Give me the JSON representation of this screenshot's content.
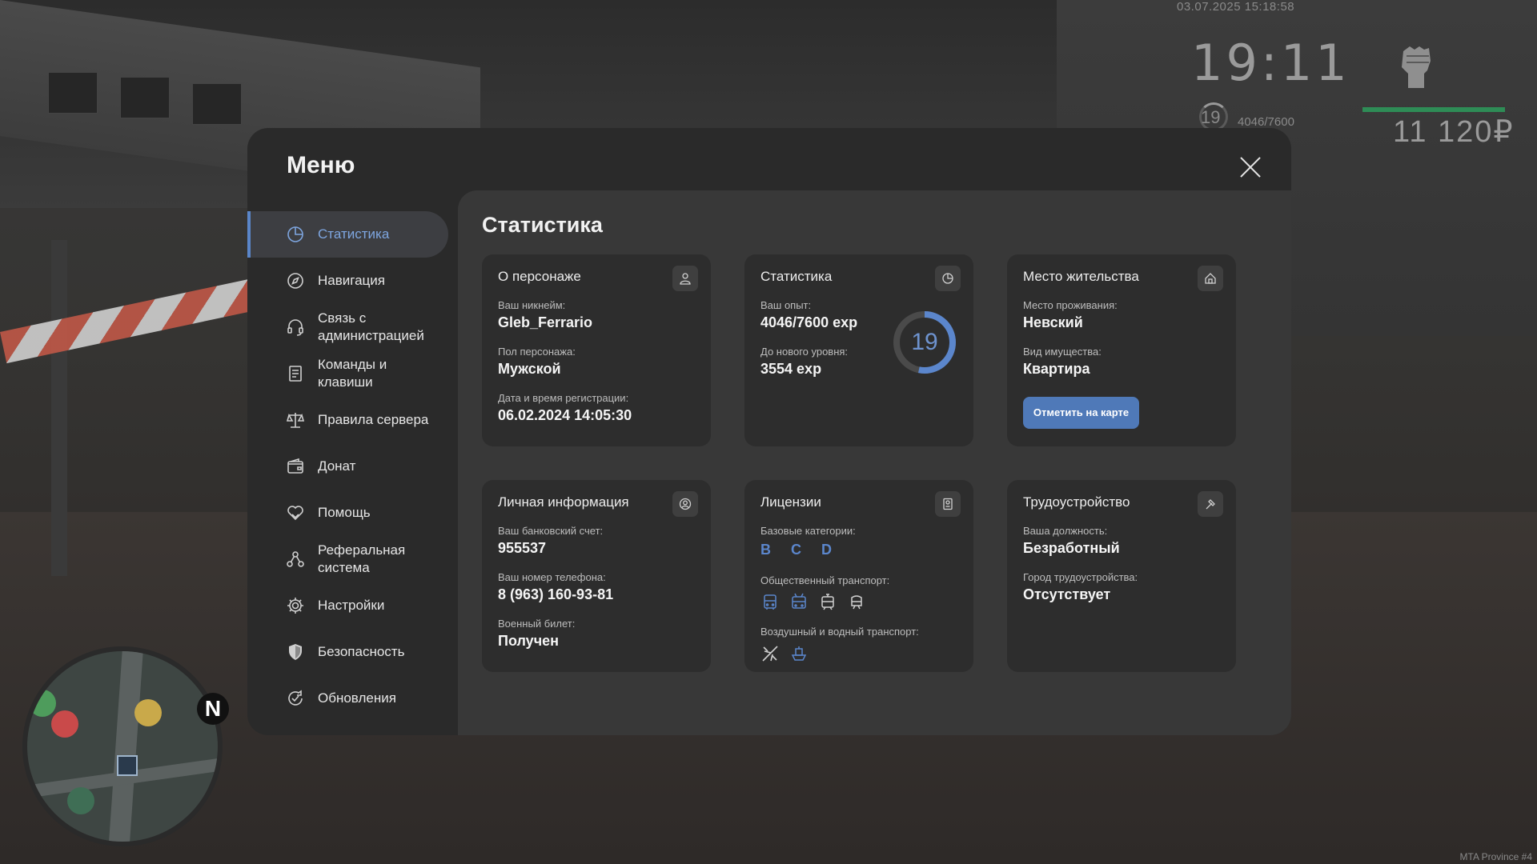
{
  "hud": {
    "datetime": "03.07.2025 15:18:58",
    "time": "19:11",
    "level": "19",
    "exp": "4046/7600",
    "money": "11 120₽",
    "watermark": "MTA Province #4",
    "minimap_north": "N",
    "colors": {
      "hp_bar": "#2e8c56"
    }
  },
  "menu": {
    "title": "Меню",
    "sidebar": [
      {
        "label": "Статистика",
        "icon": "pie-chart-icon",
        "active": true
      },
      {
        "label": "Навигация",
        "icon": "compass-icon"
      },
      {
        "label": "Связь с администрацией",
        "icon": "headset-icon"
      },
      {
        "label": "Команды и клавиши",
        "icon": "document-list-icon"
      },
      {
        "label": "Правила сервера",
        "icon": "scales-icon"
      },
      {
        "label": "Донат",
        "icon": "wallet-icon"
      },
      {
        "label": "Помощь",
        "icon": "heart-hands-icon"
      },
      {
        "label": "Реферальная система",
        "icon": "referral-icon"
      },
      {
        "label": "Настройки",
        "icon": "gear-icon"
      },
      {
        "label": "Безопасность",
        "icon": "shield-icon"
      },
      {
        "label": "Обновления",
        "icon": "refresh-check-icon"
      }
    ],
    "accent_color": "#5a86c9"
  },
  "stats": {
    "title": "Статистика",
    "character": {
      "title": "О персонаже",
      "nickname_label": "Ваш никнейм:",
      "nickname": "Gleb_Ferrario",
      "gender_label": "Пол персонажа:",
      "gender": "Мужской",
      "regdate_label": "Дата и время регистрации:",
      "regdate": "06.02.2024 14:05:30"
    },
    "statistics": {
      "title": "Статистика",
      "exp_label": "Ваш опыт:",
      "exp": "4046/7600 exp",
      "next_label": "До нового уровня:",
      "next": "3554 exp",
      "level": "19",
      "progress": 0.532
    },
    "residence": {
      "title": "Место жительства",
      "place_label": "Место проживания:",
      "place": "Невский",
      "property_label": "Вид имущества:",
      "property": "Квартира",
      "button": "Отметить на карте"
    },
    "personal": {
      "title": "Личная информация",
      "bank_label": "Ваш банковский счет:",
      "bank": "955537",
      "phone_label": "Ваш номер телефона:",
      "phone": "8 (963) 160-93-81",
      "military_label": "Военный билет:",
      "military": "Получен"
    },
    "licenses": {
      "title": "Лицензии",
      "base_label": "Базовые категории:",
      "base": "B C D",
      "public_label": "Общественный транспорт:",
      "public_icons": [
        "bus-icon",
        "trolleybus-icon",
        "tram-icon",
        "metro-icon"
      ],
      "air_label": "Воздушный и водный транспорт:",
      "air_icons": [
        "plane-icon",
        "boat-icon"
      ]
    },
    "job": {
      "title": "Трудоустройство",
      "position_label": "Ваша должность:",
      "position": "Безработный",
      "city_label": "Город трудоустройства:",
      "city": "Отсутствует"
    }
  }
}
